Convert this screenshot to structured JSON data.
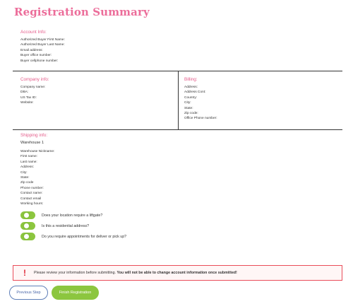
{
  "page": {
    "title": "Registration Summary"
  },
  "account": {
    "heading": "Account Info:",
    "fields": [
      "Authorized Buyer First Name:",
      "Authorized Buyer Last Name:",
      "Email address:",
      "Buyer office number:",
      "Buyer cellphone number:"
    ]
  },
  "company": {
    "heading": "Company info:",
    "fields": [
      "Company name:",
      "DBA:",
      "US Tax ID:",
      "Website:"
    ]
  },
  "billing": {
    "heading": "Billing:",
    "fields": [
      "Address:",
      "Address Cont:",
      "Country:",
      "City:",
      "State:",
      "Zip code:",
      "Office Phone number:"
    ]
  },
  "shipping": {
    "heading": "Shipping info:",
    "warehouse": "Warehouse 1",
    "fields": [
      "Warehouse Nickname:",
      "First name:",
      "Last name:",
      "Address:",
      "City:",
      "State:",
      "Zip code",
      "Phone number:",
      "Contact name:",
      "Contact email",
      "Working hours:"
    ],
    "toggles": [
      {
        "label": "Does your location require a liftgate?",
        "on": true
      },
      {
        "label": "Is this a residential address?",
        "on": true
      },
      {
        "label": "Do you require appointments for deliver or pick up?",
        "on": true
      }
    ]
  },
  "alert": {
    "icon": "!",
    "text_normal": "Please review your information before submitting.",
    "text_bold": "You will not be able to change account information once submitted!"
  },
  "buttons": {
    "previous": "Previous Step",
    "finish": "Finish Registration"
  },
  "colors": {
    "title": "#ec6d9a",
    "accent_green": "#8cc63f",
    "alert_red": "#e02d3c",
    "button_blue": "#4a67a8"
  }
}
